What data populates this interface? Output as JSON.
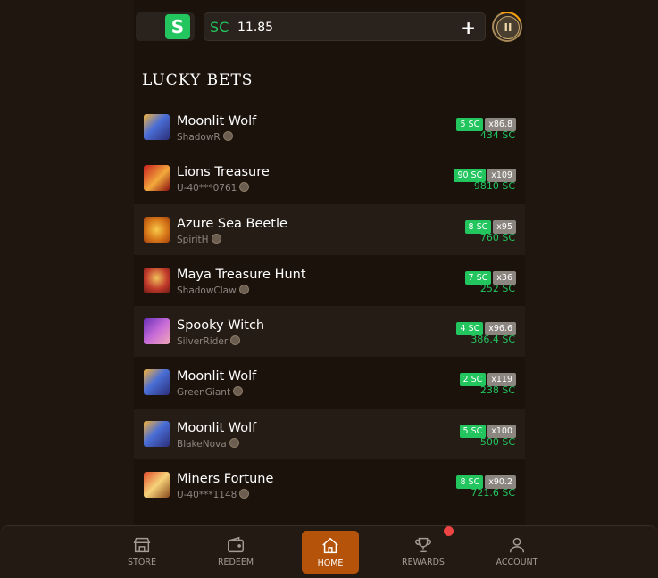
{
  "header": {
    "logo_letter": "S",
    "currency": "SC",
    "balance": "11.85",
    "add_label": "+",
    "level_label": "II"
  },
  "section_title": "LUCKY BETS",
  "bets": [
    {
      "game": "Moonlit Wolf",
      "user": "ShadowR",
      "bet": "5 SC",
      "multiplier": "x86.8",
      "win": "434 SC",
      "thumb": "wolf"
    },
    {
      "game": "Lions Treasure",
      "user": "U-40***0761",
      "bet": "90 SC",
      "multiplier": "x109",
      "win": "9810 SC",
      "thumb": "lion"
    },
    {
      "game": "Azure Sea Beetle",
      "user": "SpiritH",
      "bet": "8 SC",
      "multiplier": "x95",
      "win": "760 SC",
      "thumb": "beetle"
    },
    {
      "game": "Maya Treasure Hunt",
      "user": "ShadowClaw",
      "bet": "7 SC",
      "multiplier": "x36",
      "win": "252 SC",
      "thumb": "maya"
    },
    {
      "game": "Spooky Witch",
      "user": "SilverRider",
      "bet": "4 SC",
      "multiplier": "x96.6",
      "win": "386.4 SC",
      "thumb": "witch"
    },
    {
      "game": "Moonlit Wolf",
      "user": "GreenGiant",
      "bet": "2 SC",
      "multiplier": "x119",
      "win": "238 SC",
      "thumb": "wolf"
    },
    {
      "game": "Moonlit Wolf",
      "user": "BlakeNova",
      "bet": "5 SC",
      "multiplier": "x100",
      "win": "500 SC",
      "thumb": "wolf"
    },
    {
      "game": "Miners Fortune",
      "user": "U-40***1148",
      "bet": "8 SC",
      "multiplier": "x90.2",
      "win": "721.6 SC",
      "thumb": "miner"
    }
  ],
  "nav": [
    {
      "label": "STORE",
      "icon": "store-icon"
    },
    {
      "label": "REDEEM",
      "icon": "wallet-icon"
    },
    {
      "label": "HOME",
      "icon": "home-icon",
      "active": true
    },
    {
      "label": "REWARDS",
      "icon": "trophy-icon"
    },
    {
      "label": "ACCOUNT",
      "icon": "user-icon"
    }
  ],
  "colors": {
    "accent_green": "#22c55e",
    "nav_active": "#b45309",
    "notification": "#ef4444"
  }
}
